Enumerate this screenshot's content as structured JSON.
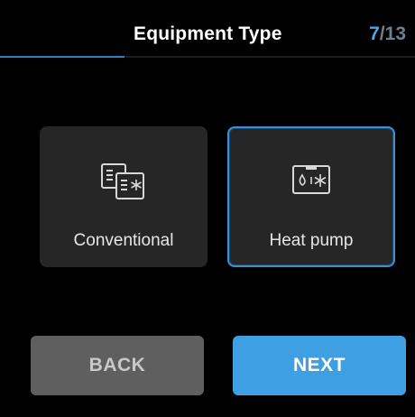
{
  "header": {
    "title": "Equipment Type",
    "step_current": "7",
    "step_separator": "/",
    "step_total": "13",
    "progress_fraction": 0.3
  },
  "options": [
    {
      "label": "Conventional",
      "icon": "conventional-equipment-icon",
      "selected": false
    },
    {
      "label": "Heat pump",
      "icon": "heat-pump-icon",
      "selected": true
    }
  ],
  "buttons": {
    "back_label": "BACK",
    "next_label": "NEXT"
  },
  "colors": {
    "accent": "#3f9fe3",
    "selected_border": "#3d8fd3",
    "card_background": "#262626",
    "back_button": "#5f5f5f",
    "background": "#000000"
  }
}
